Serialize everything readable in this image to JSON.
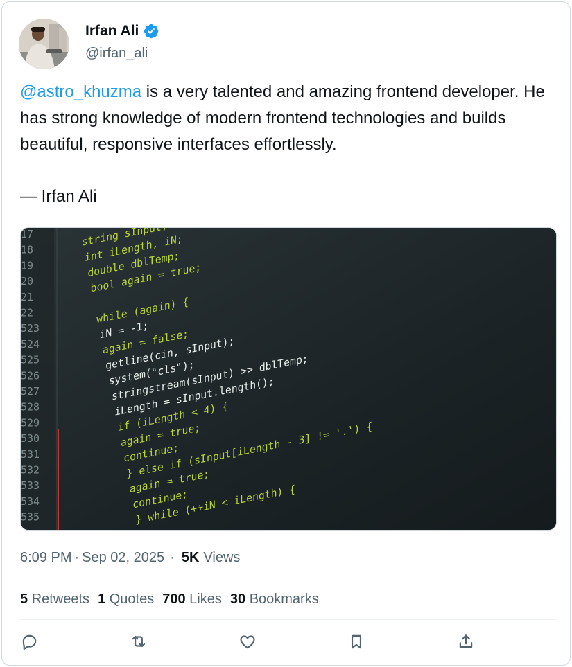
{
  "author": {
    "name": "Irfan Ali",
    "handle": "@irfan_ali",
    "verified": true,
    "verified_color": "#1d9bf0"
  },
  "tweet": {
    "mention": "@astro_khuzma",
    "text": " is a very talented and amazing frontend developer. He has strong knowledge of modern frontend technologies and builds beautiful, responsive interfaces effortlessly.",
    "signature": "— Irfan Ali"
  },
  "media": {
    "code_lines": [
      {
        "num": "17",
        "code": "string sInput;"
      },
      {
        "num": "18",
        "code": "int iLength, iN;"
      },
      {
        "num": "19",
        "code": "double dblTemp;"
      },
      {
        "num": "20",
        "code": "bool again = true;"
      },
      {
        "num": "21",
        "code": ""
      },
      {
        "num": "22",
        "code": "while (again) {"
      },
      {
        "num": "523",
        "code": "    iN = -1;"
      },
      {
        "num": "524",
        "code": "    again = false;"
      },
      {
        "num": "525",
        "code": "    getline(cin, sInput);"
      },
      {
        "num": "526",
        "code": "    system(\"cls\");"
      },
      {
        "num": "527",
        "code": "    stringstream(sInput) >> dblTemp;"
      },
      {
        "num": "528",
        "code": "    iLength = sInput.length();"
      },
      {
        "num": "529",
        "code": "    if (iLength < 4) {"
      },
      {
        "num": "530",
        "code": "        again = true;"
      },
      {
        "num": "531",
        "code": "        continue;"
      },
      {
        "num": "532",
        "code": "    } else if (sInput[iLength - 3] != '.') {"
      },
      {
        "num": "533",
        "code": "        again = true;"
      },
      {
        "num": "534",
        "code": "        continue;"
      },
      {
        "num": "535",
        "code": "    } while (++iN < iLength) {"
      }
    ]
  },
  "meta": {
    "time": "6:09 PM",
    "date": "Sep 02, 2025",
    "separator": "·",
    "views_count": "5K",
    "views_label": "Views"
  },
  "stats": {
    "retweets_count": "5",
    "retweets_label": "Retweets",
    "quotes_count": "1",
    "quotes_label": "Quotes",
    "likes_count": "700",
    "likes_label": "Likes",
    "bookmarks_count": "30",
    "bookmarks_label": "Bookmarks"
  },
  "actions": {
    "icons": [
      "reply-icon",
      "retweet-icon",
      "like-icon",
      "bookmark-icon",
      "share-icon"
    ],
    "icon_color": "#536471"
  },
  "colors": {
    "accent": "#1d9bf0",
    "text_primary": "#0f1419",
    "text_secondary": "#536471",
    "border": "#cfd9de"
  }
}
